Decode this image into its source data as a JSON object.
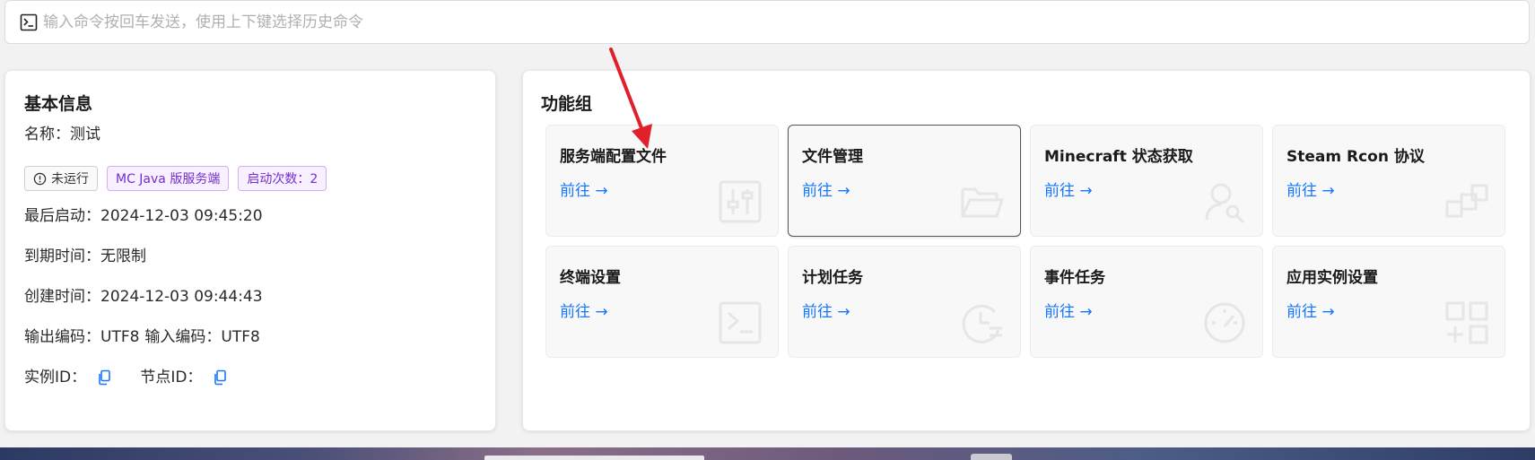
{
  "command_bar": {
    "placeholder": "输入命令按回车发送，使用上下键选择历史命令",
    "icon": "terminal-icon"
  },
  "basic_info": {
    "title": "基本信息",
    "name_label": "名称：",
    "name_value": "测试",
    "tags": [
      {
        "label": "未运行",
        "icon": "info-circle-icon",
        "style": "grey"
      },
      {
        "label": "MC Java 版服务端",
        "style": "purple"
      },
      {
        "label": "启动次数：2",
        "style": "purple"
      }
    ],
    "last_start_label": "最后启动：",
    "last_start_value": "2024-12-03 09:45:20",
    "expire_label": "到期时间：",
    "expire_value": "无限制",
    "created_label": "创建时间：",
    "created_value": "2024-12-03 09:44:43",
    "output_encoding_label": "输出编码：",
    "output_encoding_value": "UTF8",
    "input_encoding_label": "输入编码：",
    "input_encoding_value": "UTF8",
    "instance_id_label": "实例ID：",
    "node_id_label": "节点ID："
  },
  "function_group": {
    "title": "功能组",
    "tiles": [
      {
        "title": "服务端配置文件",
        "link": "前往 →",
        "icon": "sliders-icon"
      },
      {
        "title": "文件管理",
        "link": "前往 →",
        "icon": "folder-open-icon"
      },
      {
        "title": "Minecraft 状态获取",
        "link": "前往 →",
        "icon": "user-search-icon"
      },
      {
        "title": "Steam Rcon 协议",
        "link": "前往 →",
        "icon": "blocks-icon"
      },
      {
        "title": "终端设置",
        "link": "前往 →",
        "icon": "terminal-icon"
      },
      {
        "title": "计划任务",
        "link": "前往 →",
        "icon": "clock-arrow-icon"
      },
      {
        "title": "事件任务",
        "link": "前往 →",
        "icon": "dashboard-icon"
      },
      {
        "title": "应用实例设置",
        "link": "前往 →",
        "icon": "app-grid-plus-icon"
      }
    ]
  },
  "colors": {
    "link": "#1677ff",
    "purple_tag_text": "#722ed1",
    "purple_tag_bg": "#f9f0ff",
    "annotation_arrow": "#e0202a"
  }
}
